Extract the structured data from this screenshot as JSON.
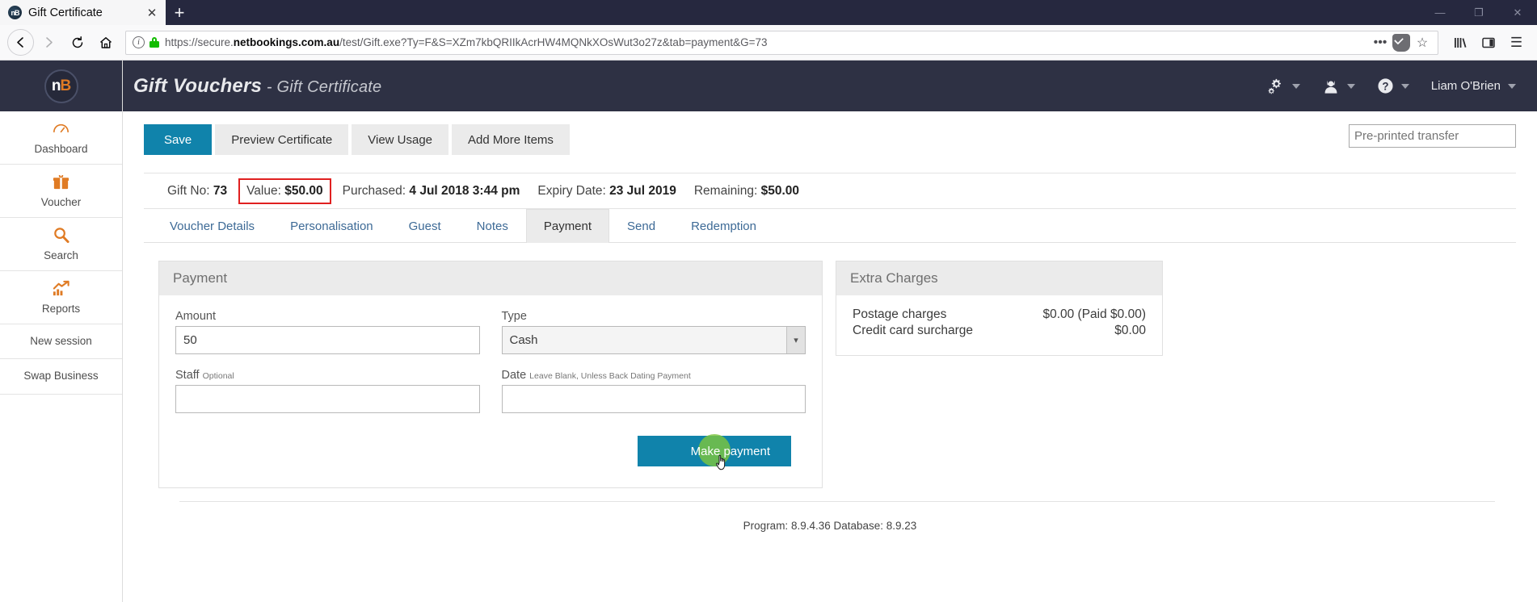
{
  "browser": {
    "tab": {
      "title": "Gift Certificate",
      "favicon_text": "nB",
      "close_icon": "close-icon"
    },
    "newtab_label": "+",
    "window_controls": {
      "minimize": "—",
      "maximize": "❐",
      "close": "✕"
    },
    "nav": {
      "back": "←",
      "forward": "→",
      "reload": "↻",
      "home": "⌂"
    },
    "url": {
      "scheme": "https://secure.",
      "domain": "netbookings.com.au",
      "path": "/test/Gift.exe?Ty=F&S=XZm7kbQRIIkAcrHW4MQNkXOsWut3o27z&tab=payment&G=73",
      "full": "https://secure.netbookings.com.au/test/Gift.exe?Ty=F&S=XZm7kbQRIIkAcrHW4MQNkXOsWut3o27z&tab=payment&G=73",
      "page_actions": "•••",
      "bookmark_star": "☆"
    },
    "toolbar_right": {
      "library": "library-icon",
      "sidebar": "sidebar-icon",
      "menu": "☰"
    }
  },
  "sidebar": {
    "logo": {
      "n": "n",
      "b": "B"
    },
    "items": [
      {
        "label": "Dashboard",
        "icon": "dashboard-icon"
      },
      {
        "label": "Voucher",
        "icon": "gift-icon"
      },
      {
        "label": "Search",
        "icon": "search-icon"
      },
      {
        "label": "Reports",
        "icon": "chart-icon"
      },
      {
        "label": "New session",
        "icon": ""
      },
      {
        "label": "Swap Business",
        "icon": ""
      }
    ]
  },
  "header": {
    "title": "Gift Vouchers",
    "separator": " - ",
    "subtitle": "Gift Certificate",
    "user_name": "Liam O'Brien",
    "icons": {
      "settings": "gears-icon",
      "staff": "user-icon",
      "help": "help-icon"
    },
    "help_glyph": "?"
  },
  "toolbar": {
    "save_label": "Save",
    "preview_label": "Preview Certificate",
    "usage_label": "View Usage",
    "additems_label": "Add More Items",
    "preprinted_placeholder": "Pre-printed transfer",
    "preprinted_value": ""
  },
  "info_bar": [
    {
      "label": "Gift No:",
      "value": "73",
      "highlight": false
    },
    {
      "label": "Value:",
      "value": "$50.00",
      "highlight": true
    },
    {
      "label": "Purchased:",
      "value": "4 Jul 2018 3:44 pm",
      "highlight": false
    },
    {
      "label": "Expiry Date:",
      "value": "23 Jul 2019",
      "highlight": false
    },
    {
      "label": "Remaining:",
      "value": "$50.00",
      "highlight": false
    }
  ],
  "tabs": [
    {
      "label": "Voucher Details",
      "active": false
    },
    {
      "label": "Personalisation",
      "active": false
    },
    {
      "label": "Guest",
      "active": false
    },
    {
      "label": "Notes",
      "active": false
    },
    {
      "label": "Payment",
      "active": true
    },
    {
      "label": "Send",
      "active": false
    },
    {
      "label": "Redemption",
      "active": false
    }
  ],
  "payment_panel": {
    "heading": "Payment",
    "amount_label": "Amount",
    "amount_value": "50",
    "type_label": "Type",
    "type_value": "Cash",
    "type_options": [
      "Cash"
    ],
    "staff_label": "Staff",
    "staff_hint": "Optional",
    "staff_value": "",
    "date_label": "Date",
    "date_hint": "Leave Blank, Unless Back Dating Payment",
    "date_value": "",
    "make_payment_label": "Make payment"
  },
  "extra_charges": {
    "heading": "Extra Charges",
    "rows": [
      {
        "label": "Postage charges",
        "value": "$0.00 (Paid $0.00)"
      },
      {
        "label": "Credit card surcharge",
        "value": "$0.00"
      }
    ]
  },
  "footer": {
    "text": "Program: 8.9.4.36 Database: 8.9.23"
  },
  "colors": {
    "brand_dark": "#2e3144",
    "accent_blue": "#1083ab",
    "accent_orange": "#e07b24",
    "highlight_red": "#e02020",
    "click_halo": "#7cc53e"
  }
}
